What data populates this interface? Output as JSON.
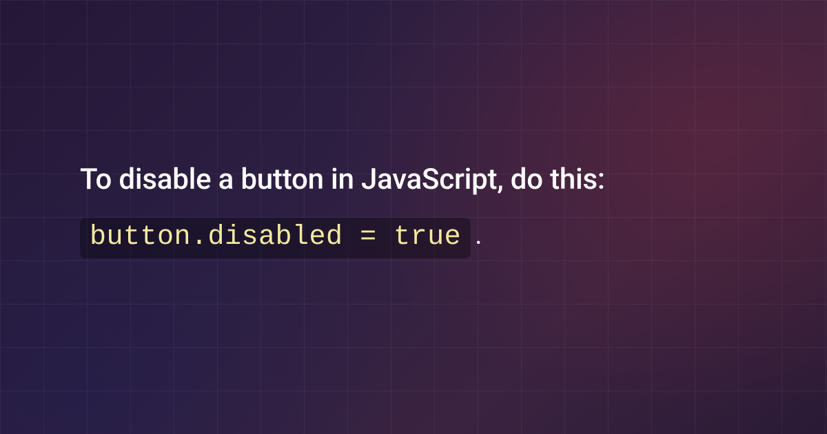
{
  "heading": "To disable a button in JavaScript, do this:",
  "code_snippet": "button.disabled = true",
  "trailing": "."
}
